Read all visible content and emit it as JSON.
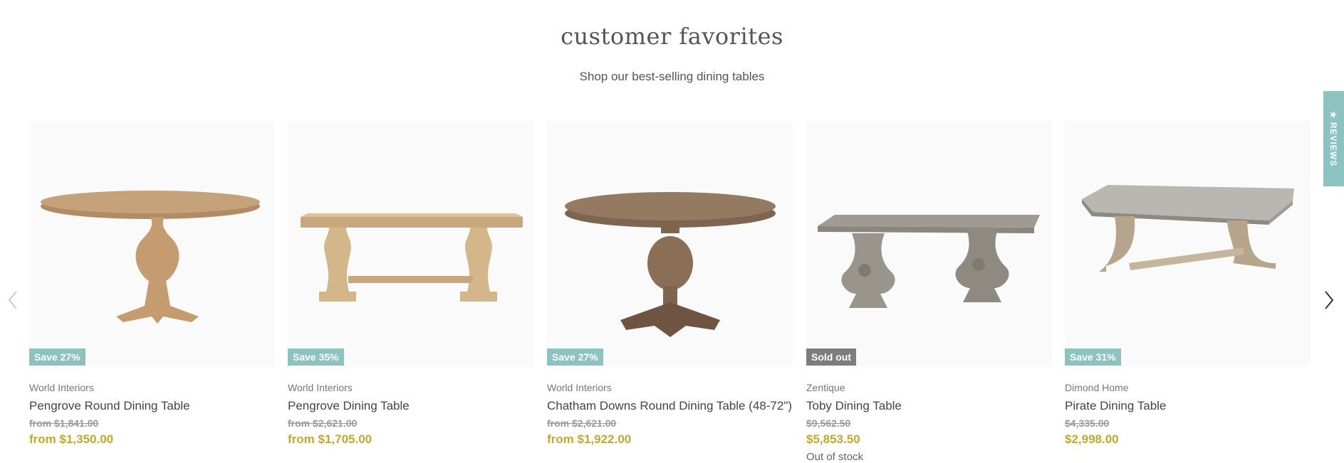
{
  "section": {
    "title": "customer favorites",
    "subtitle": "Shop our best-selling dining tables"
  },
  "reviews_tab": {
    "label": "★ REVIEWS",
    "color": "#8cc3c0"
  },
  "nav": {
    "prev_icon": "chevron-left-icon",
    "next_icon": "chevron-right-icon"
  },
  "colors": {
    "sale_badge": "#8cc3c0",
    "sold_badge": "#7d7d7d",
    "price": "#c0a92e"
  },
  "products": [
    {
      "badge": "Save 27%",
      "badge_type": "sale",
      "vendor": "World Interiors",
      "name": "Pengrove Round Dining Table",
      "was": "from $1,841.00",
      "now": "from $1,350.00",
      "stock": ""
    },
    {
      "badge": "Save 35%",
      "badge_type": "sale",
      "vendor": "World Interiors",
      "name": "Pengrove Dining Table",
      "was": "from $2,621.00",
      "now": "from $1,705.00",
      "stock": ""
    },
    {
      "badge": "Save 27%",
      "badge_type": "sale",
      "vendor": "World Interiors",
      "name": "Chatham Downs Round Dining Table (48-72\")",
      "was": "from $2,621.00",
      "now": "from $1,922.00",
      "stock": ""
    },
    {
      "badge": "Sold out",
      "badge_type": "sold",
      "vendor": "Zentique",
      "name": "Toby Dining Table",
      "was": "$9,562.50",
      "now": "$5,853.50",
      "stock": "Out of stock"
    },
    {
      "badge": "Save 31%",
      "badge_type": "sale",
      "vendor": "Dimond Home",
      "name": "Pirate Dining Table",
      "was": "$4,335.00",
      "now": "$2,998.00",
      "stock": ""
    }
  ]
}
